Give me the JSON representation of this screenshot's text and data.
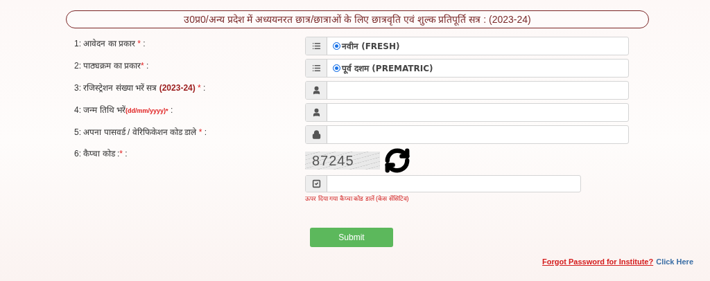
{
  "title": "उ0प्र0/अन्य प्रदेश में अध्ययनरत छात्र/छात्राओं के लिए छात्रवृति एवं शुल्क प्रतिपूर्ति सत्र : (2023-24)",
  "fields": [
    {
      "kind": "radio",
      "label": [
        {
          "text": "1: आवेदन का प्रकार ",
          "kind": "plain"
        },
        {
          "text": "*",
          "kind": "required"
        },
        {
          "text": " :",
          "kind": "plain"
        }
      ],
      "option": {
        "label": "नवीन (FRESH)",
        "selected": true
      }
    },
    {
      "kind": "radio",
      "label": [
        {
          "text": "2: पाठ्यक्रम का प्रकार",
          "kind": "plain"
        },
        {
          "text": "*",
          "kind": "required"
        },
        {
          "text": " :",
          "kind": "plain"
        }
      ],
      "option": {
        "label": "पूर्व दशम (PREMATRIC)",
        "selected": true
      }
    },
    {
      "kind": "text",
      "label": [
        {
          "text": "3: रजिस्ट्रेशन संख्या भरें सत्र ",
          "kind": "plain"
        },
        {
          "text": "(2023-24)",
          "kind": "emphasis"
        },
        {
          "text": " *",
          "kind": "required"
        },
        {
          "text": " :",
          "kind": "plain"
        }
      ]
    },
    {
      "kind": "text",
      "label": [
        {
          "text": "4: जन्म तिथि भरें",
          "kind": "plain"
        },
        {
          "text": "(dd/mm/yyyy)*",
          "kind": "format"
        },
        {
          "text": " :",
          "kind": "plain"
        }
      ]
    },
    {
      "kind": "password",
      "label": [
        {
          "text": "5: अपना पासवर्ड / वेरिफिकेशन कोड डाले ",
          "kind": "plain"
        },
        {
          "text": "*",
          "kind": "required"
        },
        {
          "text": " :",
          "kind": "plain"
        }
      ]
    }
  ],
  "captcha": {
    "label": [
      {
        "text": "6: कैप्चा कोड :",
        "kind": "plain"
      },
      {
        "text": "*",
        "kind": "required"
      },
      {
        "text": " :",
        "kind": "plain"
      }
    ],
    "code": "87245",
    "hint": "ऊपर दिया गया कैप्चा कोड डालें (केस सेंसिटिव)"
  },
  "submit": "Submit",
  "forgot": {
    "question": "Forgot Password for Institute?",
    "link": "Click Here"
  }
}
